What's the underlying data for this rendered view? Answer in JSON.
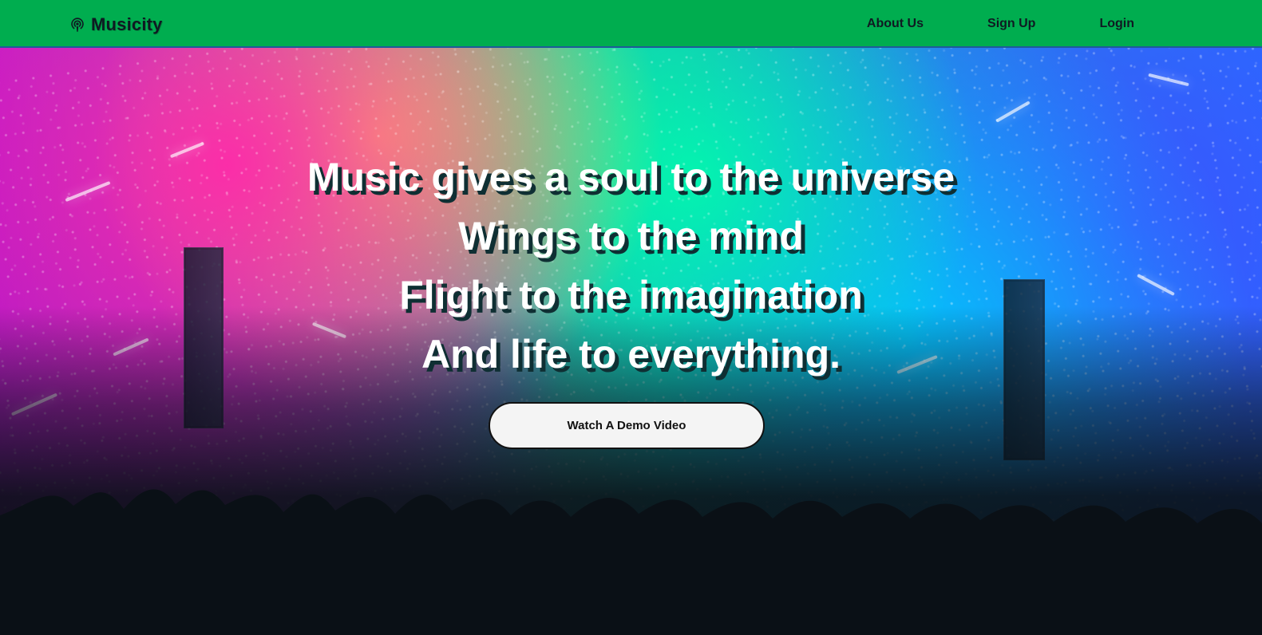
{
  "brand": {
    "name": "Musicity",
    "icon": "podcast-icon",
    "color": "#0f1a22"
  },
  "nav": {
    "items": [
      {
        "label": "About Us"
      },
      {
        "label": "Sign Up"
      },
      {
        "label": "Login"
      }
    ],
    "background": "#00ad4f"
  },
  "hero": {
    "lines": [
      "Music gives a soul to the universe",
      "Wings to the mind",
      "Flight to the imagination",
      "And life to everything."
    ],
    "cta_label": "Watch A Demo Video",
    "background_image_subject": "concert-crowd"
  }
}
